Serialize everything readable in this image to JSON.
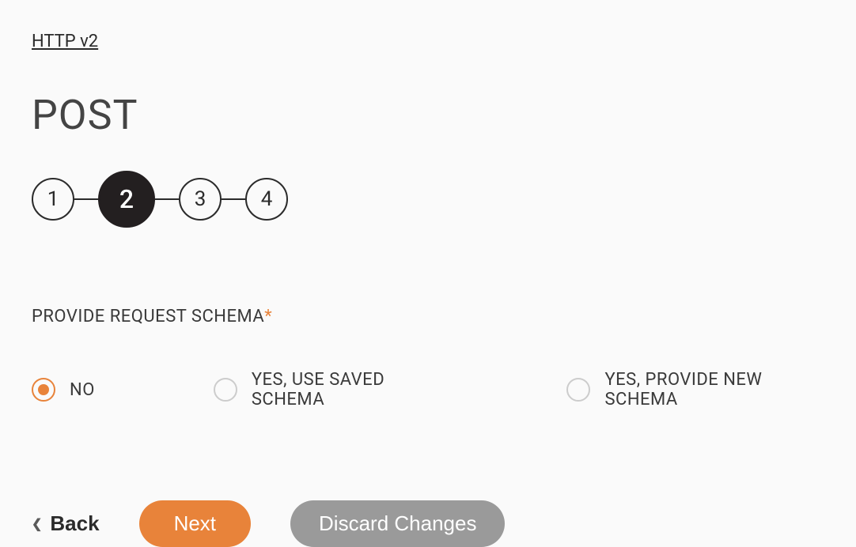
{
  "breadcrumb": {
    "label": "HTTP v2"
  },
  "page": {
    "title": "POST"
  },
  "stepper": {
    "steps": [
      "1",
      "2",
      "3",
      "4"
    ],
    "active_index": 1
  },
  "section": {
    "label": "PROVIDE REQUEST SCHEMA",
    "required_marker": "*"
  },
  "radio": {
    "options": [
      {
        "label": "NO",
        "selected": true
      },
      {
        "label": "YES, USE SAVED SCHEMA",
        "selected": false
      },
      {
        "label": "YES, PROVIDE NEW SCHEMA",
        "selected": false
      }
    ]
  },
  "actions": {
    "back_label": "Back",
    "next_label": "Next",
    "discard_label": "Discard Changes"
  }
}
